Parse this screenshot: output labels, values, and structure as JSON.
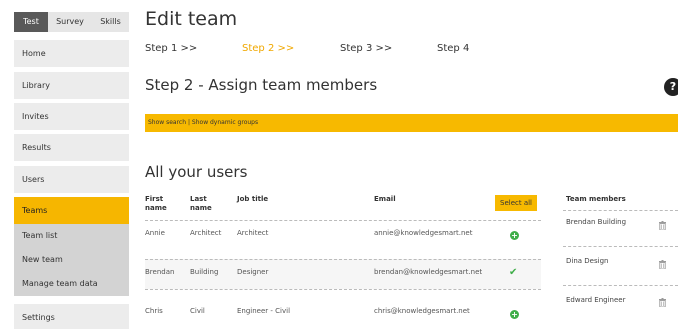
{
  "sidebar": {
    "tabs": [
      "Test",
      "Survey",
      "Skills"
    ],
    "items": [
      {
        "label": "Home"
      },
      {
        "label": "Library"
      },
      {
        "label": "Invites"
      },
      {
        "label": "Results"
      },
      {
        "label": "Users"
      },
      {
        "label": "Teams",
        "active": true
      },
      {
        "label": "Team list"
      },
      {
        "label": "New team"
      },
      {
        "label": "Manage team data"
      },
      {
        "label": "Settings"
      }
    ]
  },
  "main": {
    "title": "Edit team",
    "steps": [
      "Step 1 >>",
      "Step 2 >>",
      "Step 3 >>",
      "Step 4"
    ],
    "current_step": 1,
    "step_title": "Step 2 - Assign team members",
    "help": "?",
    "bar": {
      "show_search": "Show search",
      "separator": "|",
      "show_dynamic": "Show dynamic groups"
    },
    "users_title": "All your users",
    "table": {
      "headers": {
        "first": "First name",
        "last": "Last name",
        "job": "Job title",
        "email": "Email"
      },
      "select_all": "Select all",
      "rows": [
        {
          "first": "Annie",
          "last": "Architect",
          "job": "Architect",
          "email": "annie@knowledgesmart.net",
          "status": "add"
        },
        {
          "first": "Brendan",
          "last": "Building",
          "job": "Designer",
          "email": "brendan@knowledgesmart.net",
          "status": "added"
        },
        {
          "first": "Chris",
          "last": "Civil",
          "job": "Engineer - Civil",
          "email": "chris@knowledgesmart.net",
          "status": "add"
        }
      ]
    },
    "team_members": {
      "title": "Team members",
      "items": [
        "Brendan Building",
        "Dina Design",
        "Edward Engineer"
      ]
    }
  },
  "colors": {
    "accent": "#f7b900",
    "step_active": "#f0a800",
    "add": "#3fae49",
    "tab_active": "#595959"
  }
}
